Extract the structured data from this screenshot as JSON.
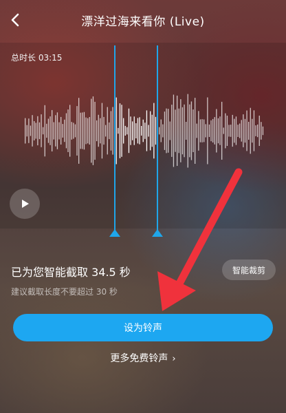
{
  "header": {
    "title": "漂洋过海来看你 (Live)",
    "back_icon": "chevron-left-icon"
  },
  "waveform": {
    "total_duration_label": "总时长 03:15",
    "play_icon": "play-icon",
    "selection_color": "#1fa6ea"
  },
  "clip": {
    "info": "已为您智能截取 34.5 秒",
    "hint": "建议截取长度不要超过 30 秒",
    "smart_button_label": "智能裁剪"
  },
  "actions": {
    "set_ringtone_label": "设为铃声",
    "more_free_label": "更多免费铃声",
    "more_chevron": "›",
    "primary_color": "#1da7f1"
  },
  "annotation": {
    "arrow_color": "#f0323c"
  }
}
